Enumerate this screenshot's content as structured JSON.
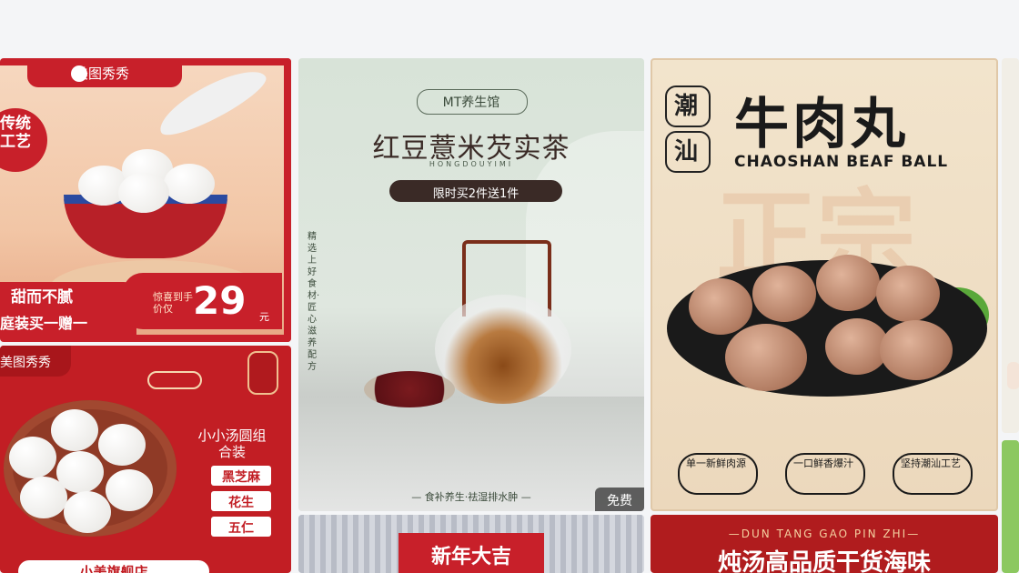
{
  "feed": {
    "cards": [
      {
        "id": "tangyuan-banner",
        "brand": "美图秀秀",
        "badge": "传统工艺",
        "ribbon1": "甜而不腻",
        "ribbon2": "庭装买一赠一",
        "price_prefix": "惊喜到手价仅",
        "price": "29",
        "currency": "元"
      },
      {
        "id": "tangyuan-shop",
        "brand": "美图秀秀",
        "title": "小小汤圆组合装",
        "flavors": [
          "黑芝麻",
          "花生",
          "五仁"
        ],
        "shop": "小美旗舰店"
      },
      {
        "id": "tea-poster",
        "pill": "MT养生馆",
        "title": "红豆薏米芡实茶",
        "subtitle": "HONGDOUYIMI",
        "promo": "限时买2件送1件",
        "vertical": "精选上好食材·匠心滋养配方",
        "footer": "— 食补养生·祛湿排水肿 —",
        "free_badge": "免费"
      },
      {
        "id": "new-year",
        "title": "新年大吉"
      },
      {
        "id": "beef-ball",
        "seal1": "潮",
        "seal2": "汕",
        "title": "牛肉丸",
        "subtitle": "CHAOSHAN BEAF BALL",
        "bg_text": "正宗风味",
        "pills": [
          "单一新鲜肉源",
          "一口鲜香爆汁",
          "坚持潮汕工艺"
        ]
      },
      {
        "id": "stew-dry-goods",
        "en": "—DUN TANG GAO PIN ZHI—",
        "title": "炖汤高品质干货海味"
      }
    ]
  },
  "colors": {
    "background": "#f4f5f7",
    "festive_red": "#c8202a",
    "tea_green": "#d8e3d8",
    "beef_beige": "#f2e4cc"
  }
}
